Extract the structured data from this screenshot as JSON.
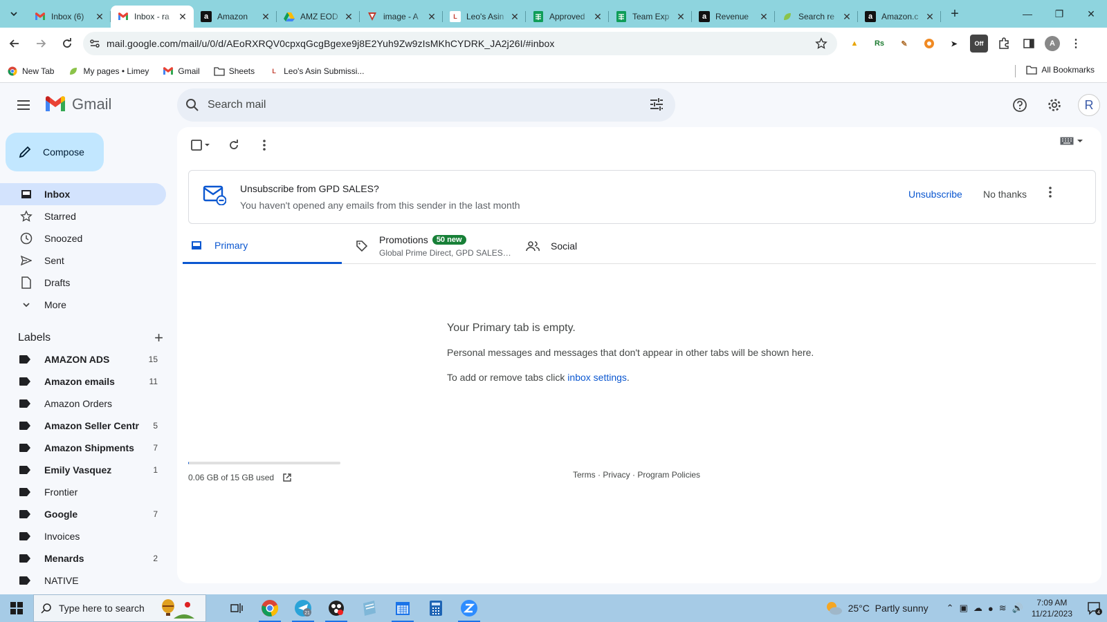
{
  "browser": {
    "tabs": [
      {
        "title": "Inbox (6)",
        "icon": "gmail-icon",
        "active": false
      },
      {
        "title": "Inbox - ra",
        "icon": "gmail-icon",
        "active": true
      },
      {
        "title": "Amazon",
        "icon": "amazon-icon",
        "active": false
      },
      {
        "title": "AMZ EOD",
        "icon": "drive-icon",
        "active": false
      },
      {
        "title": "image - A",
        "icon": "vivaldi-icon",
        "active": false
      },
      {
        "title": "Leo's Asin",
        "icon": "leo-icon",
        "active": false
      },
      {
        "title": "Approved",
        "icon": "sheets-icon",
        "active": false
      },
      {
        "title": "Team Exp",
        "icon": "sheets-icon",
        "active": false
      },
      {
        "title": "Revenue",
        "icon": "amazon-icon",
        "active": false
      },
      {
        "title": "Search re",
        "icon": "leaf-icon",
        "active": false
      },
      {
        "title": "Amazon.c",
        "icon": "amazon-icon",
        "active": false
      }
    ],
    "url": "mail.google.com/mail/u/0/d/AEoRXRQV0cpxqGcgBgexe9j8E2Yuh9Zw9zIsMKhCYDRK_JA2j26I/#inbox",
    "bookmarks": [
      {
        "label": "New Tab",
        "icon": "chrome-icon"
      },
      {
        "label": "My pages • Limey",
        "icon": "leaf-icon"
      },
      {
        "label": "Gmail",
        "icon": "gmail-icon"
      },
      {
        "label": "Sheets",
        "icon": "folder-icon"
      },
      {
        "label": "Leo's Asin Submissi...",
        "icon": "leo-icon"
      }
    ],
    "all_bookmarks": "All Bookmarks",
    "profile_initial": "A"
  },
  "gmail": {
    "logo_text": "Gmail",
    "search_placeholder": "Search mail",
    "avatar_initial": "R",
    "compose": "Compose",
    "nav": [
      {
        "label": "Inbox",
        "icon": "inbox-icon",
        "active": true
      },
      {
        "label": "Starred",
        "icon": "star-icon"
      },
      {
        "label": "Snoozed",
        "icon": "clock-icon"
      },
      {
        "label": "Sent",
        "icon": "send-icon"
      },
      {
        "label": "Drafts",
        "icon": "draft-icon"
      },
      {
        "label": "More",
        "icon": "chevron-down-icon"
      }
    ],
    "labels_heading": "Labels",
    "labels": [
      {
        "name": "AMAZON ADS",
        "count": "15",
        "bold": true
      },
      {
        "name": "Amazon emails",
        "count": "11",
        "bold": true
      },
      {
        "name": "Amazon Orders",
        "count": "",
        "bold": false
      },
      {
        "name": "Amazon Seller Centr",
        "count": "5",
        "bold": true
      },
      {
        "name": "Amazon Shipments",
        "count": "7",
        "bold": true
      },
      {
        "name": "Emily Vasquez",
        "count": "1",
        "bold": true
      },
      {
        "name": "Frontier",
        "count": "",
        "bold": false
      },
      {
        "name": "Google",
        "count": "7",
        "bold": true
      },
      {
        "name": "Invoices",
        "count": "",
        "bold": false
      },
      {
        "name": "Menards",
        "count": "2",
        "bold": true
      },
      {
        "name": "NATIVE",
        "count": "",
        "bold": false
      }
    ],
    "banner": {
      "title": "Unsubscribe from GPD SALES?",
      "subtitle": "You haven't opened any emails from this sender in the last month",
      "unsubscribe": "Unsubscribe",
      "no_thanks": "No thanks"
    },
    "tabs": {
      "primary": "Primary",
      "promotions": "Promotions",
      "promotions_badge": "50 new",
      "promotions_sub": "Global Prime Direct, GPD SALES…",
      "social": "Social"
    },
    "empty": {
      "title": "Your Primary tab is empty.",
      "line1": "Personal messages and messages that don't appear in other tabs will be shown here.",
      "line2_prefix": "To add or remove tabs click ",
      "line2_link": "inbox settings",
      "line2_suffix": "."
    },
    "storage": {
      "text": "0.06 GB of 15 GB used",
      "fraction": 0.004
    },
    "footer": {
      "terms": "Terms",
      "sep1": " · ",
      "privacy": "Privacy",
      "sep2": " · ",
      "policies": "Program Policies"
    }
  },
  "taskbar": {
    "search_placeholder": "Type here to search",
    "apps": [
      "chrome-icon",
      "telegram-icon",
      "obs-icon",
      "notepad-icon",
      "calendar-icon",
      "calculator-icon",
      "zoom-icon"
    ],
    "telegram_badge": "21",
    "weather": "25°C  Partly sunny",
    "time": "7:09 AM",
    "date": "11/21/2023",
    "notif_count": "4"
  },
  "colors": {
    "accent": "#0b57d0",
    "tabstrip": "#8ed4de",
    "compose_bg": "#c2e7ff",
    "active_nav": "#d3e3fd",
    "badge": "#188038"
  }
}
